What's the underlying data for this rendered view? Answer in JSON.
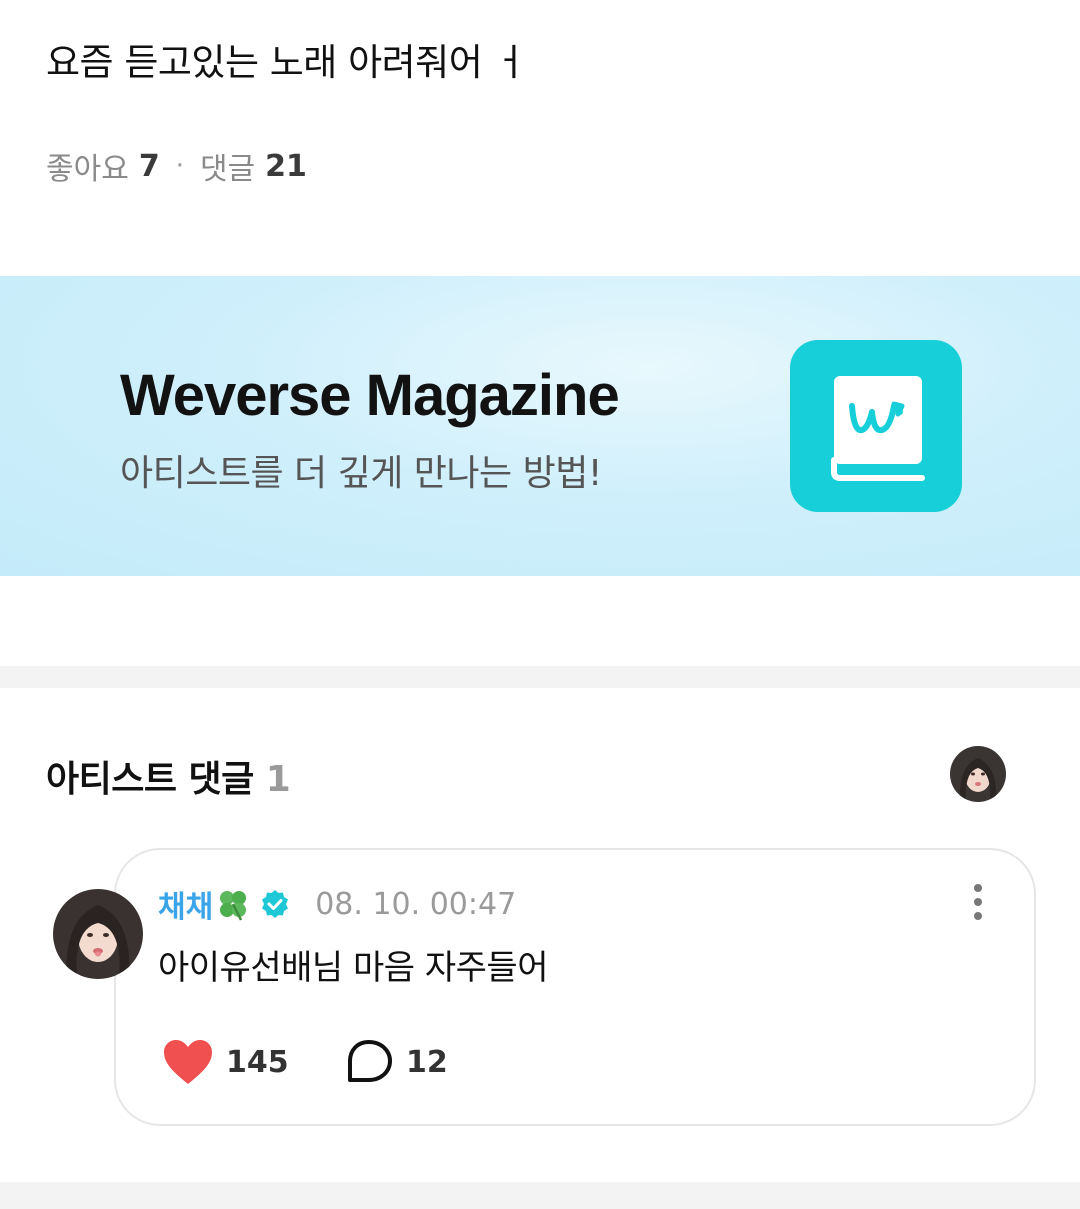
{
  "post": {
    "title": "요즘 듣고있는 노래 아려줘어 ㅓ",
    "likes_label": "좋아요",
    "likes_count": "7",
    "separator": "·",
    "comments_label": "댓글",
    "comments_count": "21"
  },
  "banner": {
    "title": "Weverse Magazine",
    "subtitle": "아티스트를 더 깊게 만나는 방법!",
    "logo_icon": "weverse-magazine-book-icon",
    "logo_color": "#16cfd8"
  },
  "artist_comments": {
    "heading": "아티스트 댓글",
    "count": "1",
    "comment": {
      "author": "채채",
      "author_emoji_icon": "four-leaf-clover-icon",
      "verified_icon": "verified-badge-icon",
      "timestamp": "08. 10. 00:47",
      "text": "아이유선배님 마음 자주들어",
      "like_count": "145",
      "reply_count": "12"
    }
  },
  "colors": {
    "author": "#3aa4e8",
    "heart": "#f0504f",
    "verified": "#1ec8d6"
  }
}
